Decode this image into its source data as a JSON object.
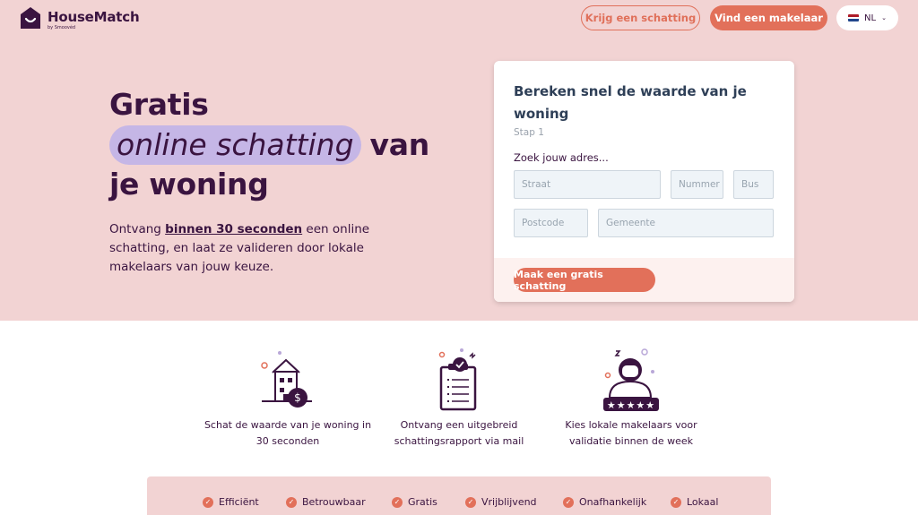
{
  "header": {
    "logo_name": "HouseMatch",
    "logo_sub": "by Smoovéd",
    "estimate_button": "Krijg een schatting",
    "agent_button": "Vind een makelaar",
    "language": "NL"
  },
  "hero": {
    "title_line1": "Gratis",
    "title_highlight": "online schatting",
    "title_line2_rest": "van",
    "title_line3": "je woning",
    "intro_before": "Ontvang ",
    "intro_bold": "binnen 30 seconden",
    "intro_after": " een online schatting, en laat ze valideren door lokale makelaars van jouw keuze."
  },
  "form": {
    "title": "Bereken snel de waarde van je woning",
    "step": "Stap 1",
    "search_label": "Zoek jouw adres...",
    "street_placeholder": "Straat",
    "number_placeholder": "Nummer",
    "box_placeholder": "Bus",
    "postcode_placeholder": "Postcode",
    "city_placeholder": "Gemeente",
    "submit": "Maak een gratis schatting"
  },
  "features": [
    {
      "text": "Schat de waarde van je woning in 30 seconden",
      "icon": "house-dollar-icon"
    },
    {
      "text": "Ontvang een uitgebreid schattingsrapport via mail",
      "icon": "clipboard-report-icon"
    },
    {
      "text": "Kies lokale makelaars voor validatie binnen de week",
      "icon": "agent-rating-icon"
    }
  ],
  "badges": [
    "Efficiënt",
    "Betrouwbaar",
    "Gratis",
    "Vrijblijvend",
    "Onafhankelijk",
    "Lokaal"
  ],
  "colors": {
    "hero_bg": "#f2d3d3",
    "accent": "#e2705a",
    "brand_dark": "#3a1440",
    "highlight": "#c5b6e6"
  }
}
